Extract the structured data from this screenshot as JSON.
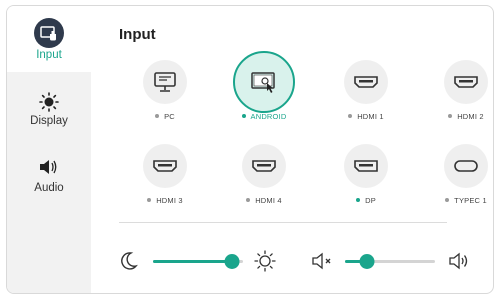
{
  "sidebar": {
    "items": [
      {
        "label": "Input",
        "icon": "input-icon",
        "active": true
      },
      {
        "label": "Display",
        "icon": "brightness-icon",
        "active": false
      },
      {
        "label": "Audio",
        "icon": "speaker-icon",
        "active": false
      }
    ]
  },
  "main": {
    "title": "Input",
    "sources": [
      {
        "label": "PC",
        "icon": "monitor-icon",
        "selected": false,
        "signal": false
      },
      {
        "label": "ANDROID",
        "icon": "android-input-icon",
        "selected": true,
        "signal": true
      },
      {
        "label": "HDMI 1",
        "icon": "hdmi-port-icon",
        "selected": false,
        "signal": false
      },
      {
        "label": "HDMI 2",
        "icon": "hdmi-port-icon",
        "selected": false,
        "signal": false
      },
      {
        "label": "HDMI 3",
        "icon": "hdmi-port-icon",
        "selected": false,
        "signal": false
      },
      {
        "label": "HDMI 4",
        "icon": "hdmi-port-icon",
        "selected": false,
        "signal": false
      },
      {
        "label": "DP",
        "icon": "displayport-icon",
        "selected": false,
        "signal": true
      },
      {
        "label": "TYPEC 1",
        "icon": "usb-c-port-icon",
        "selected": false,
        "signal": false
      }
    ],
    "brightness": {
      "level": 0.88,
      "min_icon": "moon-icon",
      "max_icon": "sun-icon"
    },
    "volume": {
      "level": 0.24,
      "min_icon": "mute-icon",
      "max_icon": "volume-high-icon"
    }
  },
  "colors": {
    "accent": "#1aa58c",
    "sidebar_bg": "#f2f2f2",
    "badge_bg": "#2f3a4c",
    "icon_circle": "#efefef"
  }
}
